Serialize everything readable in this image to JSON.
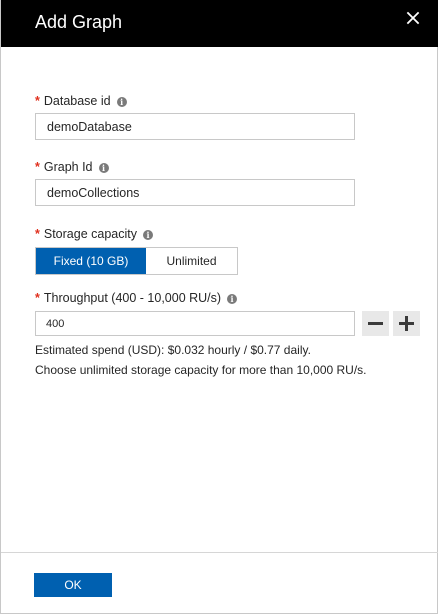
{
  "header": {
    "title": "Add Graph",
    "close_icon": "close-icon"
  },
  "fields": {
    "database_id": {
      "required_mark": "*",
      "label": "Database id",
      "info_icon": "info-icon",
      "value": "demoDatabase"
    },
    "graph_id": {
      "required_mark": "*",
      "label": "Graph Id",
      "info_icon": "info-icon",
      "value": "demoCollections"
    },
    "storage_capacity": {
      "required_mark": "*",
      "label": "Storage capacity",
      "info_icon": "info-icon",
      "options": [
        "Fixed (10 GB)",
        "Unlimited"
      ],
      "selected": "Fixed (10 GB)"
    },
    "throughput": {
      "required_mark": "*",
      "label": "Throughput (400 - 10,000 RU/s)",
      "info_icon": "info-icon",
      "value": "400",
      "decrement_icon": "minus-icon",
      "increment_icon": "plus-icon"
    }
  },
  "notes": {
    "estimated_spend": "Estimated spend (USD): $0.032 hourly / $0.77 daily.",
    "unlimited_hint": "Choose unlimited storage capacity for more than 10,000 RU/s."
  },
  "footer": {
    "ok_label": "OK"
  },
  "colors": {
    "header_bg": "#000000",
    "accent": "#0060b0",
    "required": "#e0301e",
    "border": "#c8c8c8",
    "stepper_bg": "#e8e8e8"
  }
}
